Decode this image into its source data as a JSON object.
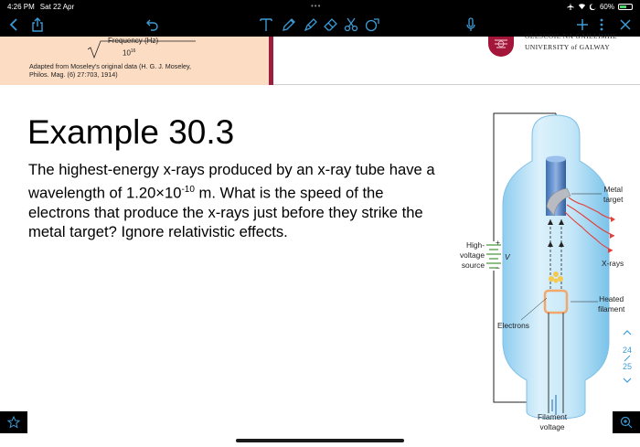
{
  "status_bar": {
    "time": "4:26 PM",
    "date": "Sat 22 Apr",
    "multitask_dots": "•••",
    "battery_percent": "60%",
    "battery_level": 0.6
  },
  "toolbar": {
    "icons": [
      "back-chevron-icon",
      "share-icon",
      "undo-icon",
      "text-tool-icon",
      "pen-icon",
      "highlighter-icon",
      "eraser-icon",
      "scissors-icon",
      "shapes-icon",
      "microphone-icon",
      "add-icon",
      "more-icon",
      "close-icon"
    ]
  },
  "prev_page": {
    "freq_label": "Frequency (Hz)",
    "freq_base": "10",
    "freq_exp": "16",
    "adapted_line1": "Adapted from Moseley's original data (H. G. J. Moseley,",
    "adapted_line2": "Philos. Mag. (6) 27:703, 1914)",
    "uni_line1": "OLLSCOIL NA GAILLIMHE",
    "uni_line2": "UNIVERSITY of GALWAY"
  },
  "slide": {
    "title": "Example 30.3",
    "body_line1": "The highest-energy x-rays produced by an x-ray tube have a",
    "body_line2_pre": "wavelength of 1.20×10",
    "body_line2_exp": "-10",
    "body_line2_post": " m. What is the speed of the",
    "body_line3": "electrons that produce the x-rays just before they strike the",
    "body_line4": "metal target? Ignore relativistic effects."
  },
  "diagram": {
    "metal_target_1": "Metal",
    "metal_target_2": "target",
    "high_1": "High-",
    "high_2": "voltage",
    "high_3": "source",
    "v_symbol": "V",
    "plus": "+",
    "minus": "−",
    "xrays": "X-rays",
    "heated_1": "Heated",
    "heated_2": "filament",
    "electrons": "Electrons",
    "filament_1": "Filament",
    "filament_2": "voltage"
  },
  "page_nav": {
    "current": "24",
    "total": "25"
  },
  "colors": {
    "accent": "#3c9bd6",
    "strip": "#fcddc4",
    "strip_bar": "#9c1f3f"
  }
}
